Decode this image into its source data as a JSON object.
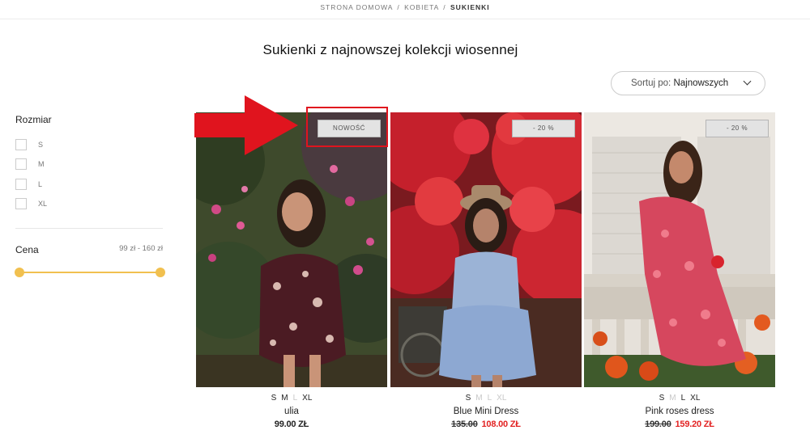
{
  "breadcrumb": {
    "home": "STRONA DOMOWA",
    "women": "KOBIETA",
    "current": "SUKIENKI",
    "separator": "/"
  },
  "page": {
    "title": "Sukienki z najnowszej kolekcji wiosennej"
  },
  "sort": {
    "label": "Sortuj po:",
    "value": "Najnowszych",
    "icon": "chevron-down-icon"
  },
  "filters": {
    "size_title": "Rozmiar",
    "sizes": [
      "S",
      "M",
      "L",
      "XL"
    ],
    "price_title": "Cena",
    "price_range": "99 zł - 160 zł",
    "accent_color": "#f1c04f"
  },
  "products": [
    {
      "badge": "NOWOŚĆ",
      "sizes": [
        {
          "label": "S",
          "available": true
        },
        {
          "label": "M",
          "available": true
        },
        {
          "label": "L",
          "available": false
        },
        {
          "label": "XL",
          "available": true
        }
      ],
      "name": "ulia",
      "price": "99.00 ZŁ",
      "old_price": ""
    },
    {
      "badge": "- 20 %",
      "sizes": [
        {
          "label": "S",
          "available": true
        },
        {
          "label": "M",
          "available": false
        },
        {
          "label": "L",
          "available": false
        },
        {
          "label": "XL",
          "available": false
        }
      ],
      "name": "Blue Mini Dress",
      "old_price": "135.00",
      "price": "108.00 ZŁ"
    },
    {
      "badge": "- 20 %",
      "sizes": [
        {
          "label": "S",
          "available": true
        },
        {
          "label": "M",
          "available": false
        },
        {
          "label": "L",
          "available": true
        },
        {
          "label": "XL",
          "available": true
        }
      ],
      "name": "Pink roses dress",
      "old_price": "199.00",
      "price": "159.20 ZŁ"
    }
  ],
  "annotation": {
    "color": "#e0141e"
  }
}
